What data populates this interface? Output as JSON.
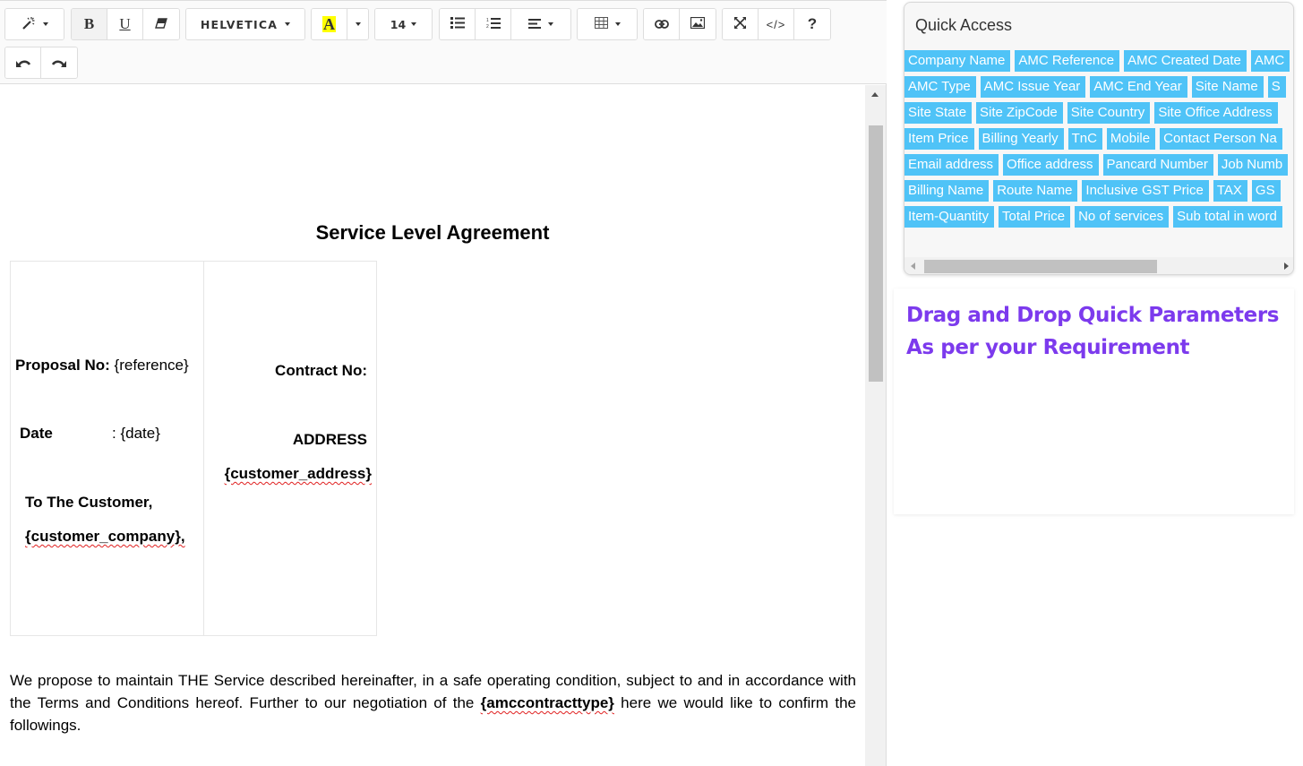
{
  "toolbar": {
    "style_button": {
      "icon": "magic-wand-icon"
    },
    "bold": {
      "label": "B"
    },
    "underline": {
      "label": "U"
    },
    "clear_format": {
      "icon": "eraser-icon"
    },
    "font_family": {
      "value": "HELVETICA"
    },
    "highlight": {
      "label": "A",
      "color": "#ffff00"
    },
    "font_size": {
      "value": "14"
    },
    "unordered_list": {
      "icon": "unordered-list-icon"
    },
    "ordered_list": {
      "icon": "ordered-list-icon"
    },
    "paragraph_align": {
      "icon": "align-icon"
    },
    "table": {
      "icon": "table-icon"
    },
    "link": {
      "icon": "link-icon"
    },
    "picture": {
      "icon": "picture-icon"
    },
    "fullscreen": {
      "icon": "fullscreen-icon"
    },
    "code_view": {
      "label": "</>"
    },
    "help": {
      "label": "?"
    },
    "undo": {
      "icon": "undo-icon"
    },
    "redo": {
      "icon": "redo-icon"
    }
  },
  "document": {
    "title": "Service Level Agreement",
    "proposal_label": "Proposal No:",
    "proposal_value": " {reference}",
    "contract_label": "Contract No:",
    "date_label": "Date",
    "date_value": ": {date}",
    "address_label": "ADDRESS",
    "address_value": "{customer_address}",
    "to_customer": "To The Customer,",
    "customer_company": "{customer_company},",
    "paragraph_before": "We propose to maintain THE Service described hereinafter, in a safe operating condition, subject to and in accordance with the Terms and Conditions hereof. Further to our negotiation of the ",
    "paragraph_placeholder": "{amccontracttype}",
    "paragraph_after": " here we would like to confirm the followings."
  },
  "quick_access": {
    "title": "Quick Access",
    "tag_color": "#4fc3f7",
    "rows": [
      [
        "Company Name",
        "AMC Reference",
        "AMC Created Date",
        "AMC"
      ],
      [
        "AMC Type",
        "AMC Issue Year",
        "AMC End Year",
        "Site Name",
        "S"
      ],
      [
        "Site State",
        "Site ZipCode",
        "Site Country",
        "Site Office Address"
      ],
      [
        "Item Price",
        "Billing Yearly",
        "TnC",
        "Mobile",
        "Contact Person Na"
      ],
      [
        "Email address",
        "Office address",
        "Pancard Number",
        "Job Numb"
      ],
      [
        "Billing Name",
        "Route Name",
        "Inclusive GST Price",
        "TAX",
        "GS"
      ],
      [
        "Item-Quantity",
        "Total Price",
        "No of services",
        "Sub total in word"
      ]
    ]
  },
  "promo": {
    "line1": "Drag and Drop Quick Parameters",
    "line2": "As per your Requirement",
    "color": "#7c3aed"
  }
}
